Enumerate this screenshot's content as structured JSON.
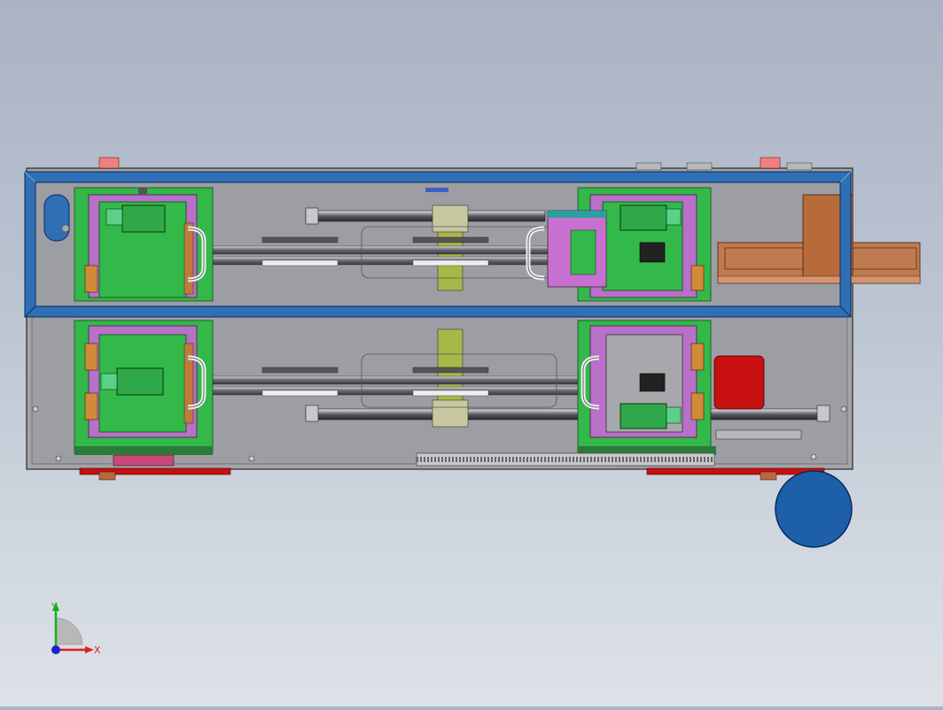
{
  "scene": {
    "background_top": "#a9b3c3",
    "background_bottom": "#dde2e8"
  },
  "triad": {
    "x_label": "X",
    "y_label": "Y",
    "x_color": "#e02020",
    "y_color": "#18b018",
    "origin_color": "#2020d0"
  },
  "colors": {
    "frame_blue": "#2f6fb6",
    "base_gray": "#a3a4a8",
    "carriage_green": "#33b84a",
    "plate_magenta": "#b870c8",
    "motor_green": "#2fa84a",
    "rail_dark": "#4a4a50",
    "red_part": "#c81010",
    "brown_part": "#b86a3a",
    "wheel_blue": "#1d5fa8",
    "olive_block": "#a8b848"
  }
}
